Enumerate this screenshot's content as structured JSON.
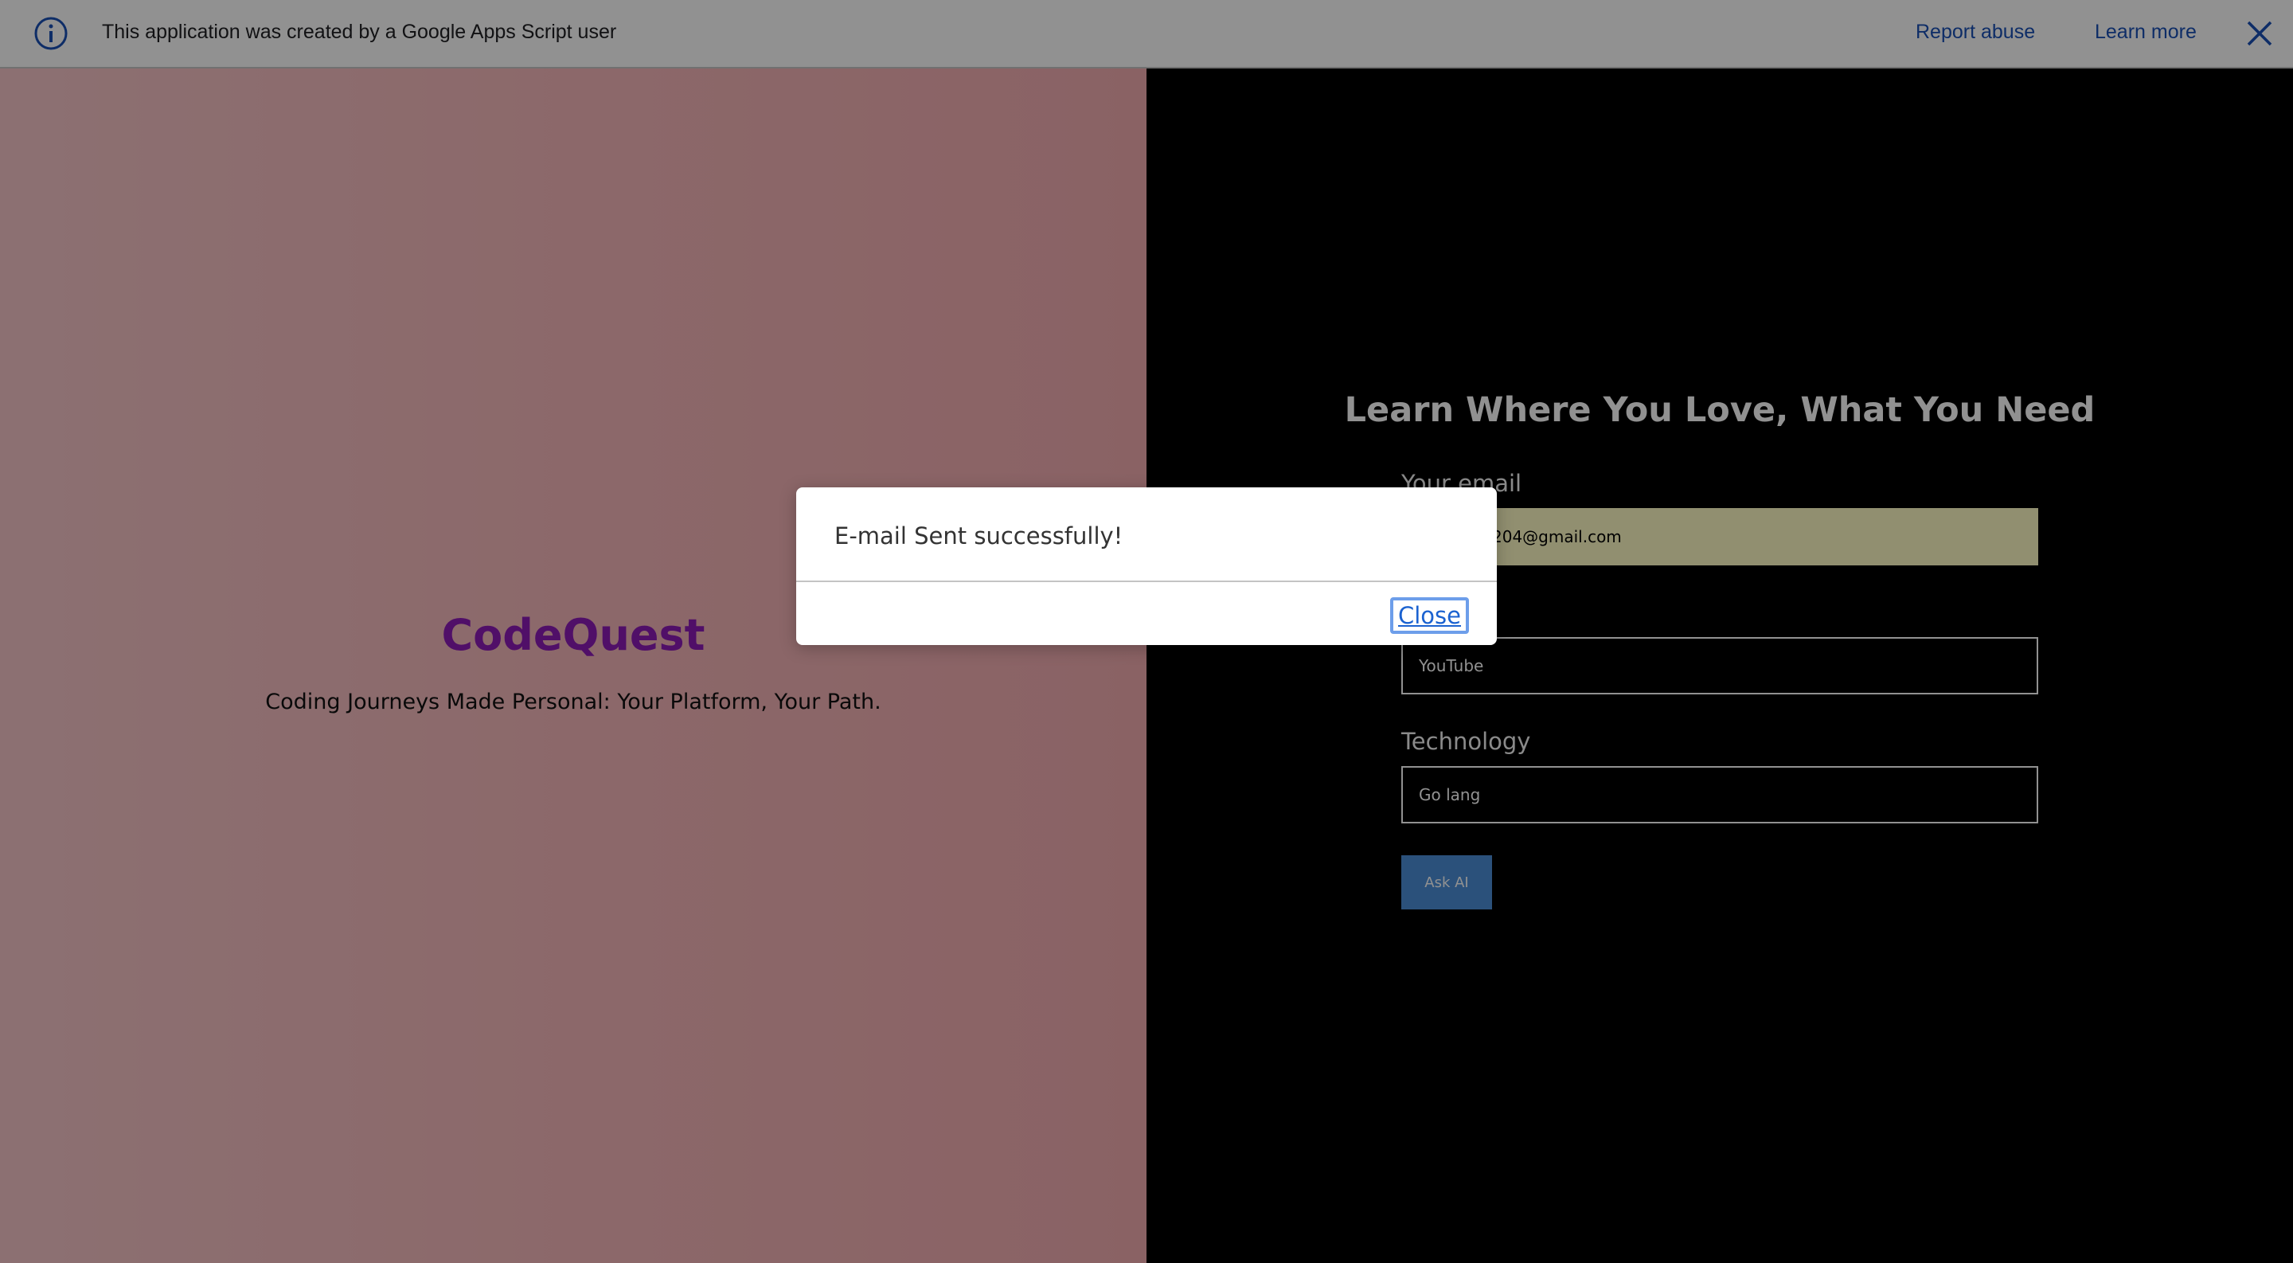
{
  "banner": {
    "message": "This application was created by a Google Apps Script user",
    "report_abuse": "Report abuse",
    "learn_more": "Learn more",
    "info_icon": "info-icon",
    "close_icon": "close-icon"
  },
  "brand": {
    "title": "CodeQuest",
    "tagline": "Coding Journeys Made Personal: Your Platform, Your Path."
  },
  "form": {
    "heading": "Learn Where You Love, What You Need",
    "email_label": "Your email",
    "email_value": "204@gmail.com",
    "platform_value": "YouTube",
    "technology_label": "Technology",
    "technology_value": "Go lang",
    "ask_button": "Ask AI"
  },
  "dialog": {
    "message": "E-mail Sent successfully!",
    "close_label": "Close"
  },
  "colors": {
    "banner_link": "#1a4fb5",
    "brand_title": "#8e1cb8",
    "ask_button": "#4c8fd8",
    "email_input_bg": "#fffcc6"
  }
}
